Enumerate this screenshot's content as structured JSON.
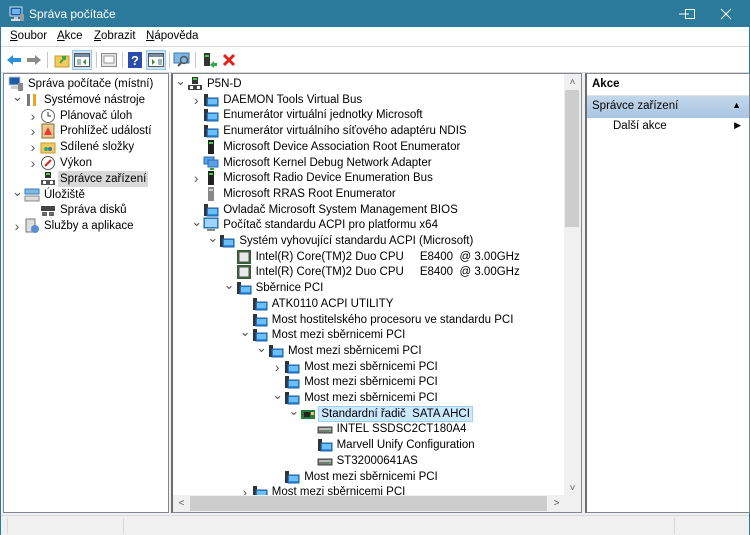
{
  "window": {
    "title": "Správa počítače",
    "controls": {
      "minimize": "—",
      "maximize": "☐",
      "close": "✕"
    }
  },
  "menubar": {
    "items": [
      {
        "label": "Soubor",
        "accel": "S",
        "rest": "oubor"
      },
      {
        "label": "Akce",
        "accel": "A",
        "rest": "kce"
      },
      {
        "label": "Zobrazit",
        "accel": "Z",
        "rest": "obrazit"
      },
      {
        "label": "Nápověda",
        "accel": "N",
        "rest": "ápověda"
      }
    ]
  },
  "toolbar": {
    "buttons": [
      {
        "name": "back",
        "icon": "arrow-left-icon"
      },
      {
        "name": "forward",
        "icon": "arrow-right-icon"
      },
      {
        "name": "up-folder",
        "icon": "folder-up-icon"
      },
      {
        "name": "show-hide-console-tree",
        "icon": "console-tree-icon",
        "active": true
      },
      {
        "name": "properties",
        "icon": "properties-icon"
      },
      {
        "name": "help",
        "icon": "help-icon"
      },
      {
        "name": "show-hide-action-pane",
        "icon": "action-pane-icon",
        "active": true
      },
      {
        "name": "scan-hardware",
        "icon": "monitor-scan-icon"
      },
      {
        "name": "update-driver",
        "icon": "update-driver-icon"
      },
      {
        "name": "uninstall-device",
        "icon": "delete-icon"
      }
    ]
  },
  "left_tree": [
    {
      "label": "Správa počítače (místní)",
      "level": 0,
      "expander": "",
      "icon": "computer-management-icon"
    },
    {
      "label": "Systémové nástroje",
      "level": 1,
      "expander": "open",
      "icon": "tools-icon"
    },
    {
      "label": "Plánovač úloh",
      "level": 2,
      "expander": "closed",
      "icon": "clock-icon"
    },
    {
      "label": "Prohlížeč událostí",
      "level": 2,
      "expander": "closed",
      "icon": "event-viewer-icon"
    },
    {
      "label": "Sdílené složky",
      "level": 2,
      "expander": "closed",
      "icon": "shared-folder-icon"
    },
    {
      "label": "Výkon",
      "level": 2,
      "expander": "closed",
      "icon": "performance-icon"
    },
    {
      "label": "Správce zařízení",
      "level": 2,
      "expander": "",
      "icon": "device-manager-icon",
      "selected": true
    },
    {
      "label": "Úložiště",
      "level": 1,
      "expander": "open",
      "icon": "storage-icon"
    },
    {
      "label": "Správa disků",
      "level": 2,
      "expander": "",
      "icon": "disk-management-icon"
    },
    {
      "label": "Služby a aplikace",
      "level": 1,
      "expander": "closed",
      "icon": "services-icon"
    }
  ],
  "device_tree": [
    {
      "label": "P5N-D",
      "level": 0,
      "expander": "open",
      "icon": "computer-root-icon"
    },
    {
      "label": "DAEMON Tools Virtual Bus",
      "level": 1,
      "expander": "closed",
      "icon": "system-device-icon"
    },
    {
      "label": "Enumerátor virtuální jednotky Microsoft",
      "level": 1,
      "expander": "",
      "icon": "system-device-icon"
    },
    {
      "label": "Enumerátor virtuálního síťového adaptéru NDIS",
      "level": 1,
      "expander": "",
      "icon": "system-device-icon"
    },
    {
      "label": "Microsoft Device Association Root Enumerator",
      "level": 1,
      "expander": "",
      "icon": "tower-icon"
    },
    {
      "label": "Microsoft Kernel Debug Network Adapter",
      "level": 1,
      "expander": "",
      "icon": "network-adapter-icon"
    },
    {
      "label": "Microsoft Radio Device Enumeration Bus",
      "level": 1,
      "expander": "closed",
      "icon": "tower-icon"
    },
    {
      "label": "Microsoft RRAS Root Enumerator",
      "level": 1,
      "expander": "",
      "icon": "tower-grey-icon"
    },
    {
      "label": "Ovladač Microsoft System Management BIOS",
      "level": 1,
      "expander": "",
      "icon": "system-device-icon"
    },
    {
      "label": "Počítač standardu ACPI pro platformu x64",
      "level": 1,
      "expander": "open",
      "icon": "monitor-icon"
    },
    {
      "label": "Systém vyhovující standardu ACPI (Microsoft)",
      "level": 2,
      "expander": "open",
      "icon": "system-device-icon"
    },
    {
      "label": "Intel(R) Core(TM)2 Duo CPU     E8400  @ 3.00GHz",
      "level": 3,
      "expander": "",
      "icon": "processor-icon"
    },
    {
      "label": "Intel(R) Core(TM)2 Duo CPU     E8400  @ 3.00GHz",
      "level": 3,
      "expander": "",
      "icon": "processor-icon"
    },
    {
      "label": "Sběrnice PCI",
      "level": 3,
      "expander": "open",
      "icon": "system-device-icon"
    },
    {
      "label": "ATK0110 ACPI UTILITY",
      "level": 4,
      "expander": "",
      "icon": "system-device-icon"
    },
    {
      "label": "Most hostitelského procesoru ve standardu PCI",
      "level": 4,
      "expander": "",
      "icon": "system-device-icon"
    },
    {
      "label": "Most mezi sběrnicemi PCI",
      "level": 4,
      "expander": "open",
      "icon": "system-device-icon"
    },
    {
      "label": "Most mezi sběrnicemi PCI",
      "level": 5,
      "expander": "open",
      "icon": "system-device-icon"
    },
    {
      "label": "Most mezi sběrnicemi PCI",
      "level": 6,
      "expander": "closed",
      "icon": "system-device-icon"
    },
    {
      "label": "Most mezi sběrnicemi PCI",
      "level": 6,
      "expander": "",
      "icon": "system-device-icon"
    },
    {
      "label": "Most mezi sběrnicemi PCI",
      "level": 6,
      "expander": "open",
      "icon": "system-device-icon"
    },
    {
      "label": "Standardní řadič  SATA AHCI",
      "level": 7,
      "expander": "open",
      "icon": "storage-controller-icon",
      "hover": true
    },
    {
      "label": "INTEL SSDSC2CT180A4",
      "level": 8,
      "expander": "",
      "icon": "disk-drive-icon"
    },
    {
      "label": "Marvell Unify Configuration",
      "level": 8,
      "expander": "",
      "icon": "system-device-icon"
    },
    {
      "label": "ST32000641AS",
      "level": 8,
      "expander": "",
      "icon": "disk-drive-icon"
    },
    {
      "label": "Most mezi sběrnicemi PCI",
      "level": 6,
      "expander": "",
      "icon": "system-device-icon"
    },
    {
      "label": "Most mezi sběrnicemi PCI",
      "level": 4,
      "expander": "closed",
      "icon": "system-device-icon"
    }
  ],
  "actions": {
    "header": "Akce",
    "group": "Správce zařízení",
    "items": [
      {
        "label": "Další akce"
      }
    ]
  },
  "scroll": {
    "up": "˄",
    "down": "˅",
    "left": "<",
    "right": ">"
  },
  "colors": {
    "titlebar": "#2b7a9b",
    "selection": "#d9d9d9",
    "hover": "#cce8ff",
    "actions_group": "#b6cde6"
  }
}
